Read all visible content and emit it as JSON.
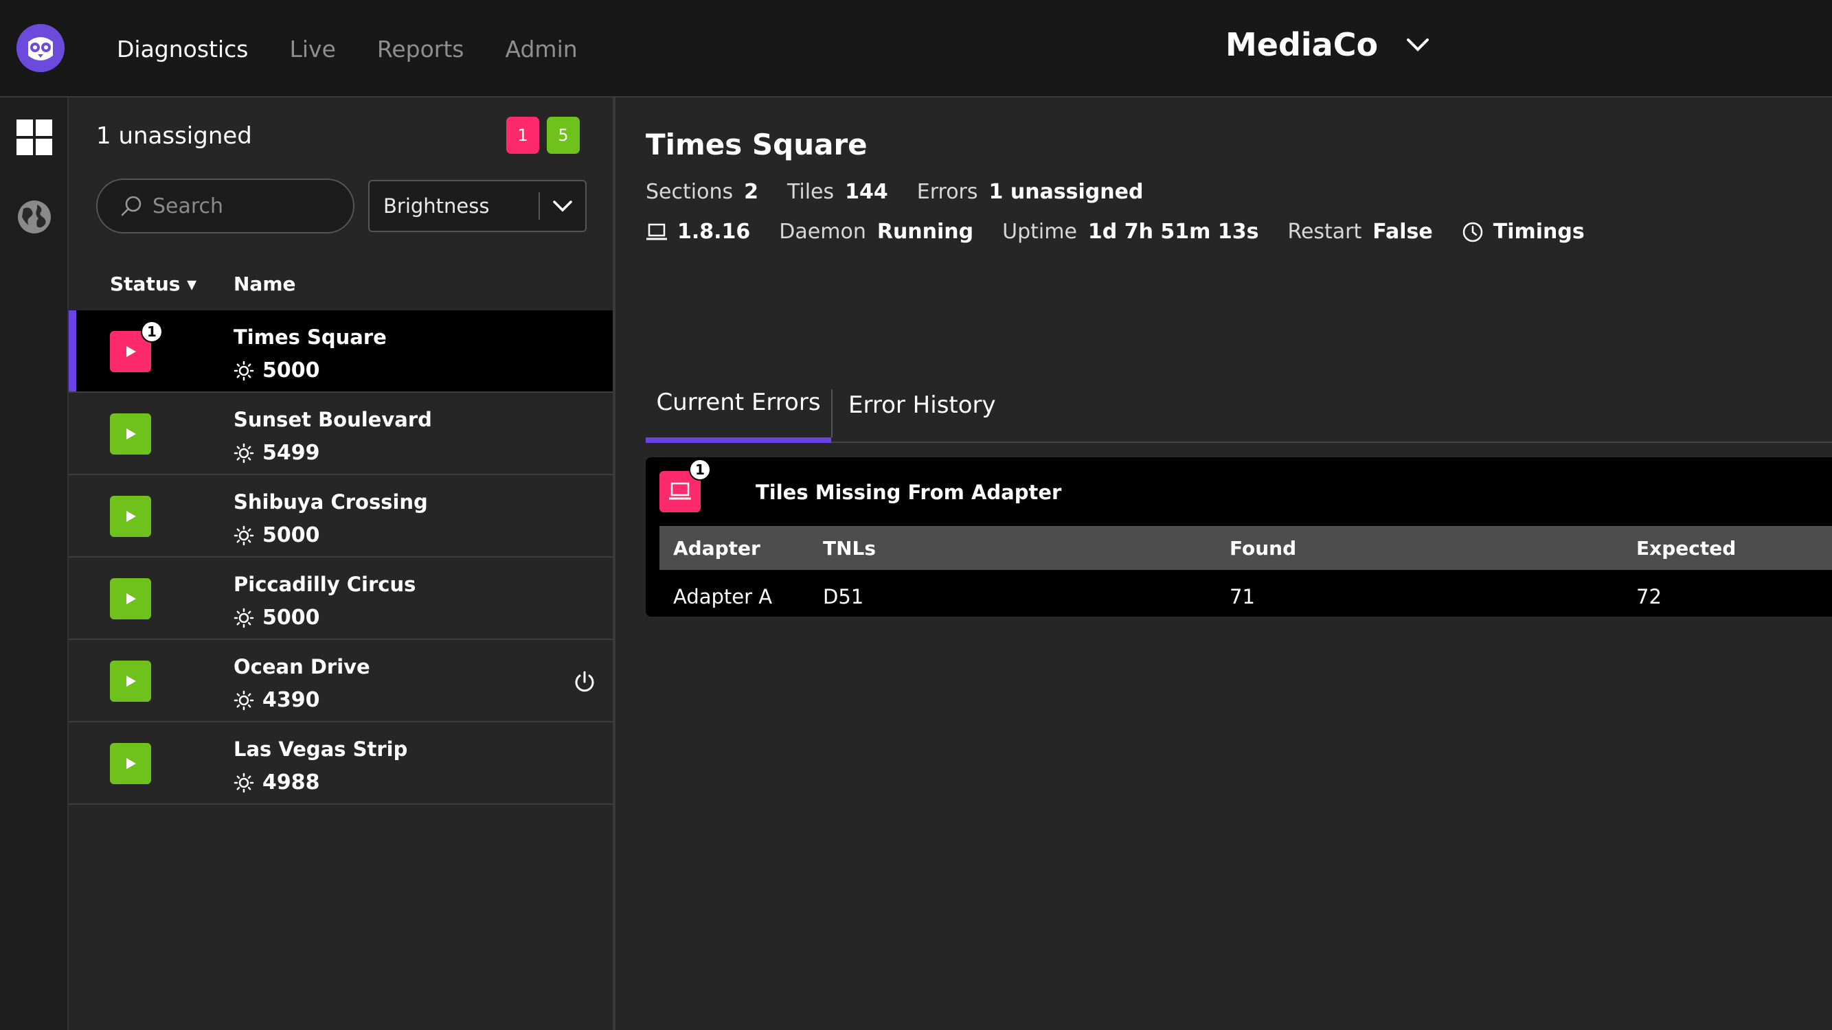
{
  "topbar": {
    "nav": [
      "Diagnostics",
      "Live",
      "Reports",
      "Admin"
    ],
    "org_name": "MediaCo"
  },
  "list": {
    "unassigned": "1 unassigned",
    "badge_red": "1",
    "badge_green": "5",
    "search_placeholder": "Search",
    "sort_select": "Brightness",
    "col_status": "Status ▾",
    "col_name": "Name",
    "rows": [
      {
        "name": "Times Square",
        "brightness": "5000",
        "status": "error",
        "errors": "1"
      },
      {
        "name": "Sunset Boulevard",
        "brightness": "5499",
        "status": "ok"
      },
      {
        "name": "Shibuya Crossing",
        "brightness": "5000",
        "status": "ok"
      },
      {
        "name": "Piccadilly Circus",
        "brightness": "5000",
        "status": "ok"
      },
      {
        "name": "Ocean Drive",
        "brightness": "4390",
        "status": "ok"
      },
      {
        "name": "Las Vegas Strip",
        "brightness": "4988",
        "status": "ok"
      }
    ]
  },
  "detail": {
    "title": "Times Square",
    "sections_label": "Sections",
    "sections_value": "2",
    "tiles_label": "Tiles",
    "tiles_value": "144",
    "errors_label": "Errors",
    "errors_value": "1 unassigned",
    "version": "1.8.16",
    "daemon_label": "Daemon",
    "daemon_value": "Running",
    "uptime_label": "Uptime",
    "uptime_value": "1d 7h 51m 13s",
    "restart_label": "Restart",
    "restart_value": "False",
    "timings_label": "Timings",
    "tabs": [
      "Current Errors",
      "Error History"
    ],
    "error": {
      "count": "1",
      "title": "Tiles Missing From Adapter",
      "headers": [
        "Adapter",
        "TNLs",
        "Found",
        "Expected"
      ],
      "row": [
        "Adapter A",
        "D51",
        "71",
        "72"
      ]
    }
  },
  "colors": {
    "accent": "#6a42e6",
    "error": "#ff2a6d",
    "ok": "#6fc21b"
  }
}
